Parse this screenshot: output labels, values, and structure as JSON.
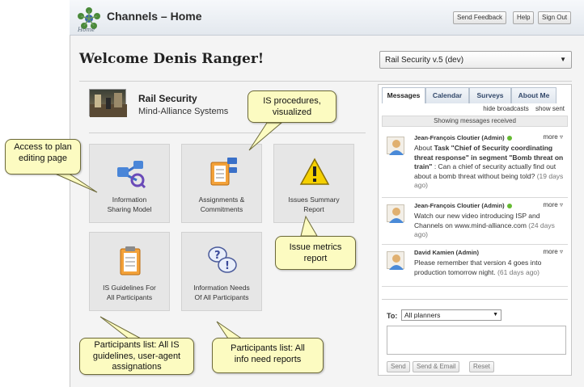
{
  "header": {
    "app_title": "Channels – Home",
    "logo_caption": "Home",
    "buttons": [
      "Send Feedback",
      "Help",
      "Sign Out"
    ]
  },
  "welcome": "Welcome Denis Ranger!",
  "plan_selector": {
    "value": "Rail Security v.5 (dev)"
  },
  "plan": {
    "name": "Rail Security",
    "owner": "Mind-Alliance Systems"
  },
  "tiles": [
    {
      "line1": "Information",
      "line2": "Sharing Model",
      "icon": "network-icon"
    },
    {
      "line1": "Assignments &",
      "line2": "Commitments",
      "icon": "assignments-icon"
    },
    {
      "line1": "Issues Summary",
      "line2": "Report",
      "icon": "warning-icon"
    },
    {
      "line1": "IS Guidelines For",
      "line2": "All Participants",
      "icon": "clipboard-icon"
    },
    {
      "line1": "Information Needs",
      "line2": "Of All Participants",
      "icon": "question-icon"
    }
  ],
  "messages_panel": {
    "tabs": [
      "Messages",
      "Calendar",
      "Surveys",
      "About Me"
    ],
    "links": [
      "hide broadcasts",
      "show sent"
    ],
    "showing": "Showing messages received",
    "more_label": "more",
    "messages": [
      {
        "from": "Jean-François Cloutier (Admin)",
        "pre": "About ",
        "bold1": "Task \"Chief of Security coordinating threat response\" in segment \"Bomb threat on train\"",
        "post": " : Can a chief of security actually find out about a bomb threat without being told?",
        "ago": "(19 days ago)"
      },
      {
        "from": "Jean-François Cloutier (Admin)",
        "text": "Watch our new video introducing ISP and Channels on www.mind-alliance.com",
        "ago": "(24 days ago)"
      },
      {
        "from": "David Kamien (Admin)",
        "text": "Please remember that version 4 goes into production tomorrow night.",
        "ago": "(61 days ago)"
      }
    ],
    "compose": {
      "to_label": "To:",
      "to_value": "All planners",
      "buttons": [
        "Send",
        "Send & Email",
        "Reset"
      ]
    }
  },
  "callouts": {
    "plan_editing": "Access to plan editing page",
    "procedures": "IS procedures, visualized",
    "issue_metrics": "Issue metrics report",
    "participants_guidelines": "Participants list: All IS guidelines, user-agent assignations",
    "participants_needs": "Participants list: All info need reports"
  }
}
